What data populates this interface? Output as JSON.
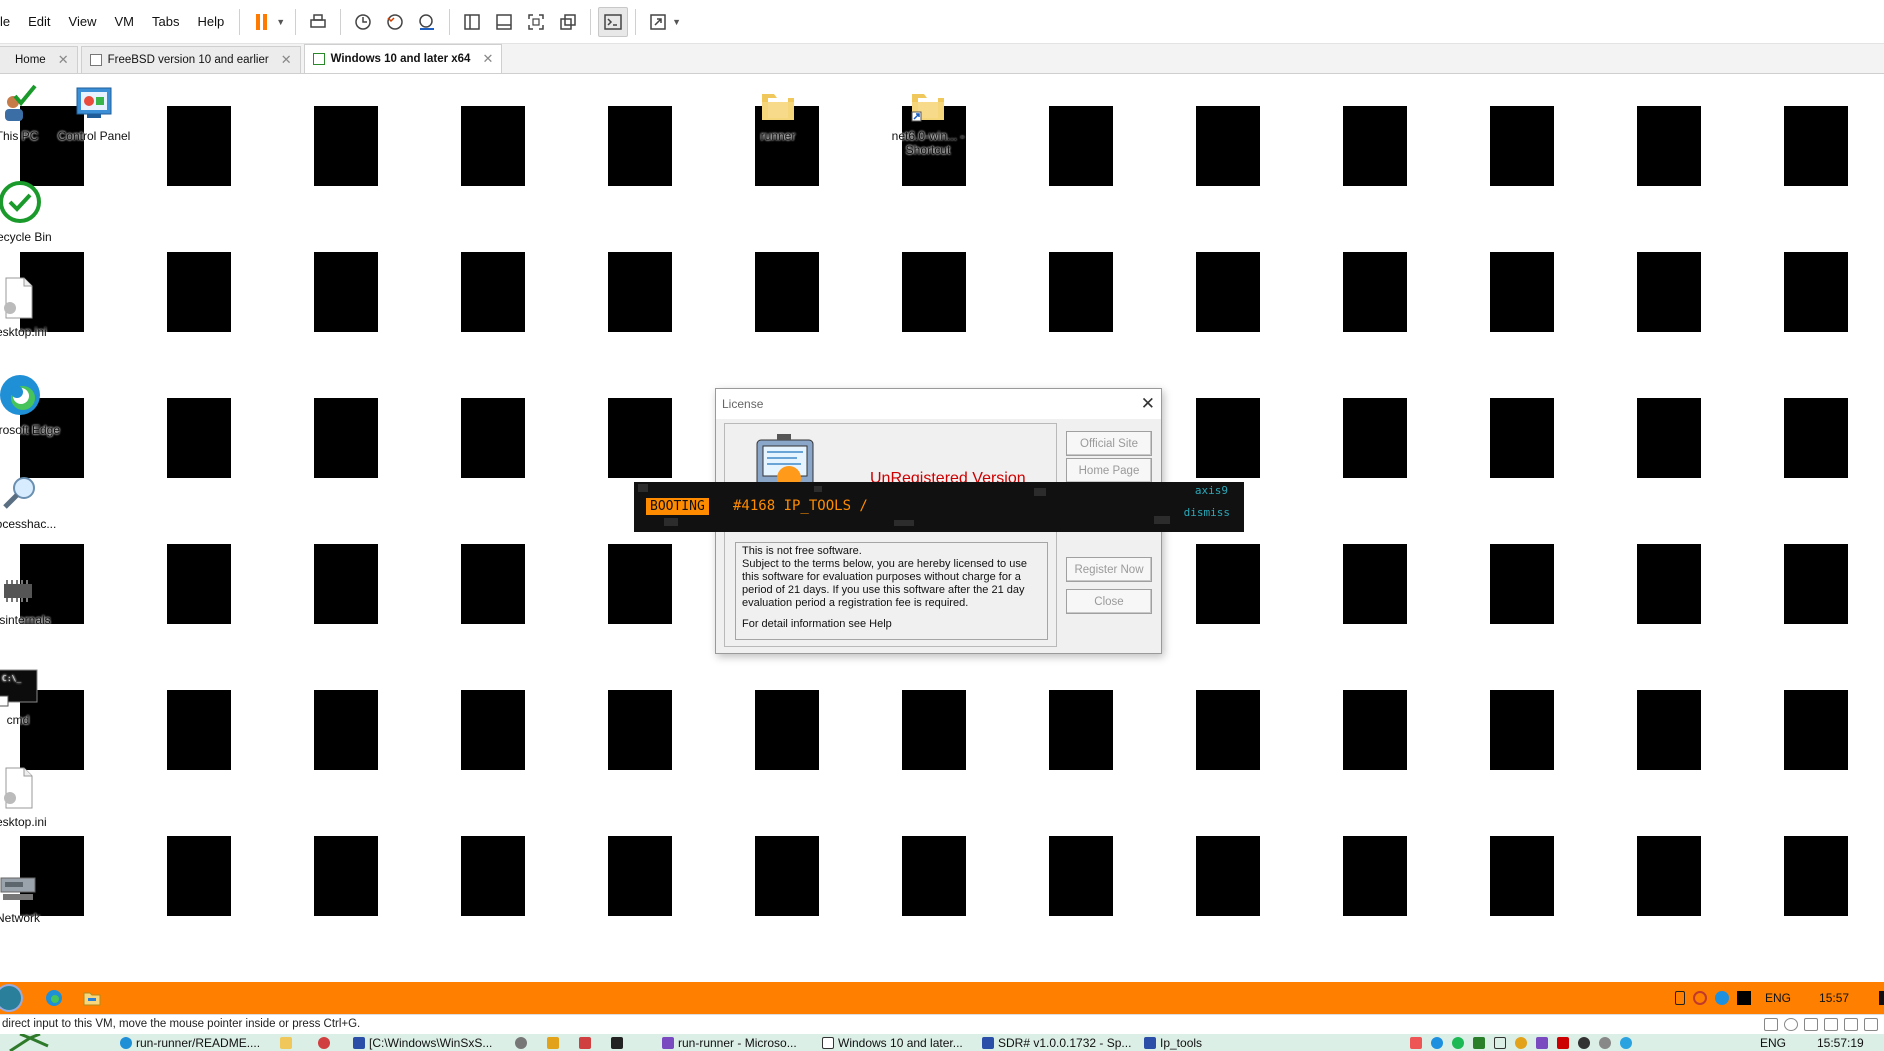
{
  "menubar": {
    "items": [
      "le",
      "Edit",
      "View",
      "VM",
      "Tabs",
      "Help"
    ]
  },
  "toolbar": {
    "icons": [
      "pause-icon",
      "send-keys-icon",
      "snapshot-icon",
      "revert-snapshot-icon",
      "snapshot-manager-icon",
      "sidebar-icon",
      "thumbnail-icon",
      "fullscreen-icon",
      "unity-icon",
      "console-icon",
      "stretch-icon"
    ]
  },
  "tabs": [
    {
      "label": "Home"
    },
    {
      "label": "FreeBSD version 10 and earlier"
    },
    {
      "label": "Windows 10 and later x64"
    }
  ],
  "desktop": {
    "icons": [
      {
        "label": "This PC"
      },
      {
        "label": "Control Panel"
      },
      {
        "label": "runner"
      },
      {
        "label": "net6.0-win... - Shortcut"
      },
      {
        "label": "Recycle Bin"
      },
      {
        "label": "desktop.ini"
      },
      {
        "label": "Microsoft Edge"
      },
      {
        "label": "Processhac..."
      },
      {
        "label": "Sysinternals"
      },
      {
        "label": "cmd"
      },
      {
        "label": "desktop.ini"
      },
      {
        "label": "Network"
      }
    ]
  },
  "license": {
    "title": "License",
    "unregistered": "UnRegistered Version",
    "text_lines": [
      "This is not free software.",
      "Subject to the terms below, you are hereby licensed to use this software for evaluation purposes without charge for a period of 21 days. If you use this software after the 21 day evaluation period a registration fee is required.",
      "For detail information see Help"
    ],
    "buttons": {
      "official_site": "Official Site",
      "home_page": "Home Page",
      "register_now": "Register Now",
      "close": "Close"
    }
  },
  "overlay": {
    "badge": "BOOTING",
    "process": "#4168 IP_TOOLS /",
    "tag": "axis9",
    "dismiss": "dismiss"
  },
  "guest_taskbar": {
    "tray": {
      "lang": "ENG",
      "time": "15:57"
    }
  },
  "status_line": {
    "text": "direct input to this VM, move the mouse pointer inside or press Ctrl+G."
  },
  "host_taskbar": {
    "items": [
      "run-runner/README....",
      "[C:\\Windows\\WinSxS...",
      "run-runner - Microso...",
      "Windows 10 and later...",
      "SDR# v1.0.0.1732 - Sp...",
      "Ip_tools"
    ],
    "lang": "ENG",
    "time": "15:57:19"
  },
  "colors": {
    "guest_taskbar": "#ff8000",
    "overlay_accent": "#ff8c00",
    "overlay_tag": "#2aa8b8",
    "unregistered": "#cc0000"
  }
}
